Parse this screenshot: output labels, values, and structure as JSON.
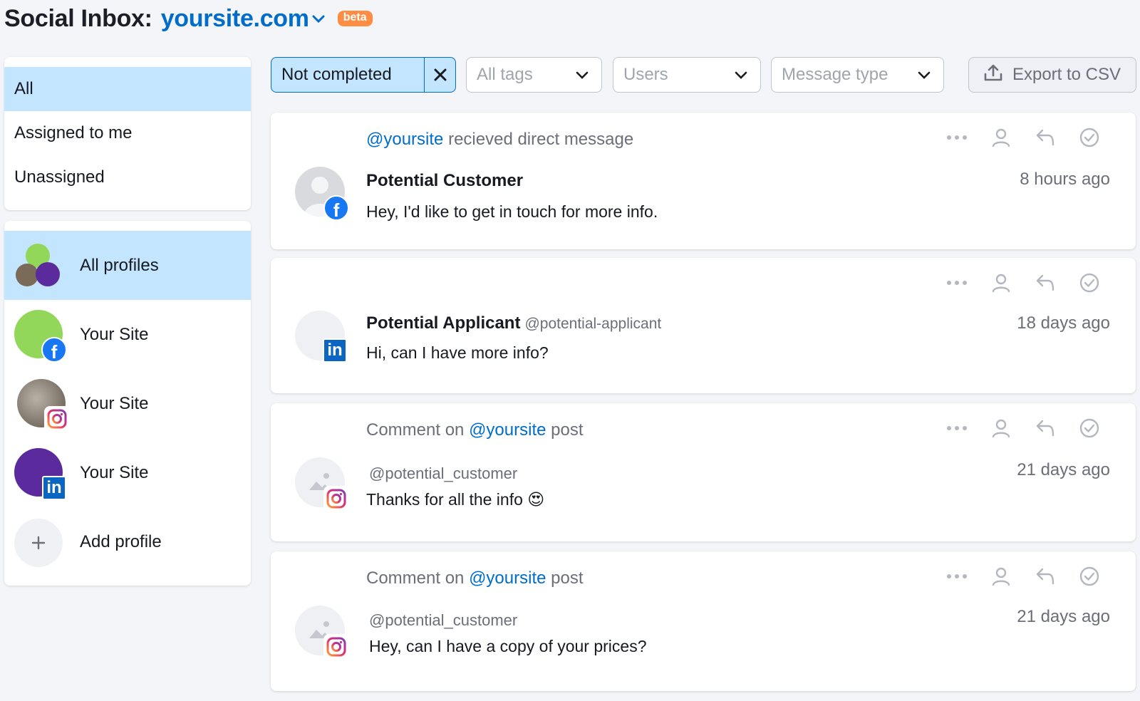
{
  "header": {
    "title": "Social Inbox:",
    "site": "yoursite.com",
    "badge": "beta"
  },
  "filters": {
    "items": [
      {
        "label": "All",
        "active": true
      },
      {
        "label": "Assigned to me",
        "active": false
      },
      {
        "label": "Unassigned",
        "active": false
      }
    ]
  },
  "profiles": {
    "items": [
      {
        "label": "All profiles"
      },
      {
        "label": "Your Site",
        "network": "facebook"
      },
      {
        "label": "Your Site",
        "network": "instagram"
      },
      {
        "label": "Your Site",
        "network": "linkedin"
      },
      {
        "label": "Add profile"
      }
    ]
  },
  "toolbar": {
    "status_value": "Not completed",
    "tags_placeholder": "All tags",
    "users_placeholder": "Users",
    "type_placeholder": "Message type",
    "export_label": "Export to CSV"
  },
  "messages": [
    {
      "context_handle": "@yoursite",
      "context_text": " recieved direct message",
      "name": "Potential Customer",
      "text": "Hey, I'd like to get in touch for more info.",
      "time": "8 hours ago",
      "network": "facebook"
    },
    {
      "name": "Potential Applicant",
      "handle": "@potential-applicant",
      "text": "Hi, can I have more info?",
      "time": "18 days ago",
      "network": "linkedin"
    },
    {
      "context_prefix": "Comment on ",
      "context_handle": "@yoursite",
      "context_suffix": " post",
      "user": "@potential_customer",
      "text": "Thanks for all the info 😍",
      "time": "21 days ago",
      "network": "instagram"
    },
    {
      "context_prefix": "Comment on ",
      "context_handle": "@yoursite",
      "context_suffix": " post",
      "user": "@potential_customer",
      "text": "Hey, can I have a copy of your prices?",
      "time": "21 days ago",
      "network": "instagram"
    }
  ],
  "colors": {
    "accent": "#006dca",
    "active_bg": "#c4e5fe",
    "beta": "#ff8c43",
    "facebook": "#1877f2",
    "linkedin": "#0a66c2"
  },
  "icons": {
    "more": "more-dots-icon",
    "assign": "user-icon",
    "reply": "reply-icon",
    "complete": "check-circle-icon",
    "export": "upload-icon",
    "clear": "close-icon",
    "dropdown": "chevron-down-icon",
    "add": "plus-icon"
  }
}
